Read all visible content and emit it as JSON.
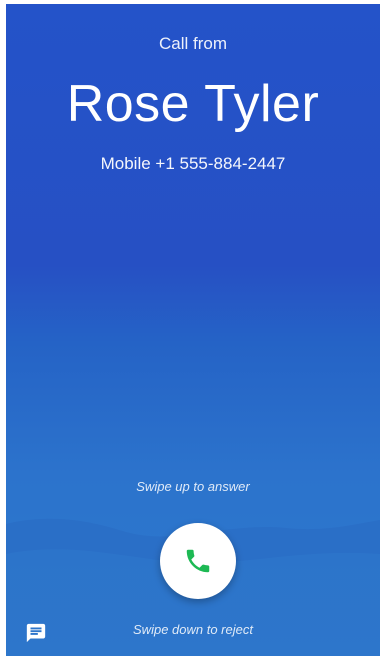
{
  "incoming_call": {
    "header": "Call from",
    "caller_name": "Rose Tyler",
    "caller_number": "Mobile +1 555-884-2447"
  },
  "actions": {
    "swipe_up_hint": "Swipe up to answer",
    "swipe_down_hint": "Swipe down to reject",
    "answer_icon": "phone-icon",
    "message_icon": "message-icon"
  },
  "colors": {
    "background_top": "#2453c9",
    "background_bottom": "#2d7ace",
    "answer_icon": "#1db954",
    "button_bg": "#ffffff"
  }
}
